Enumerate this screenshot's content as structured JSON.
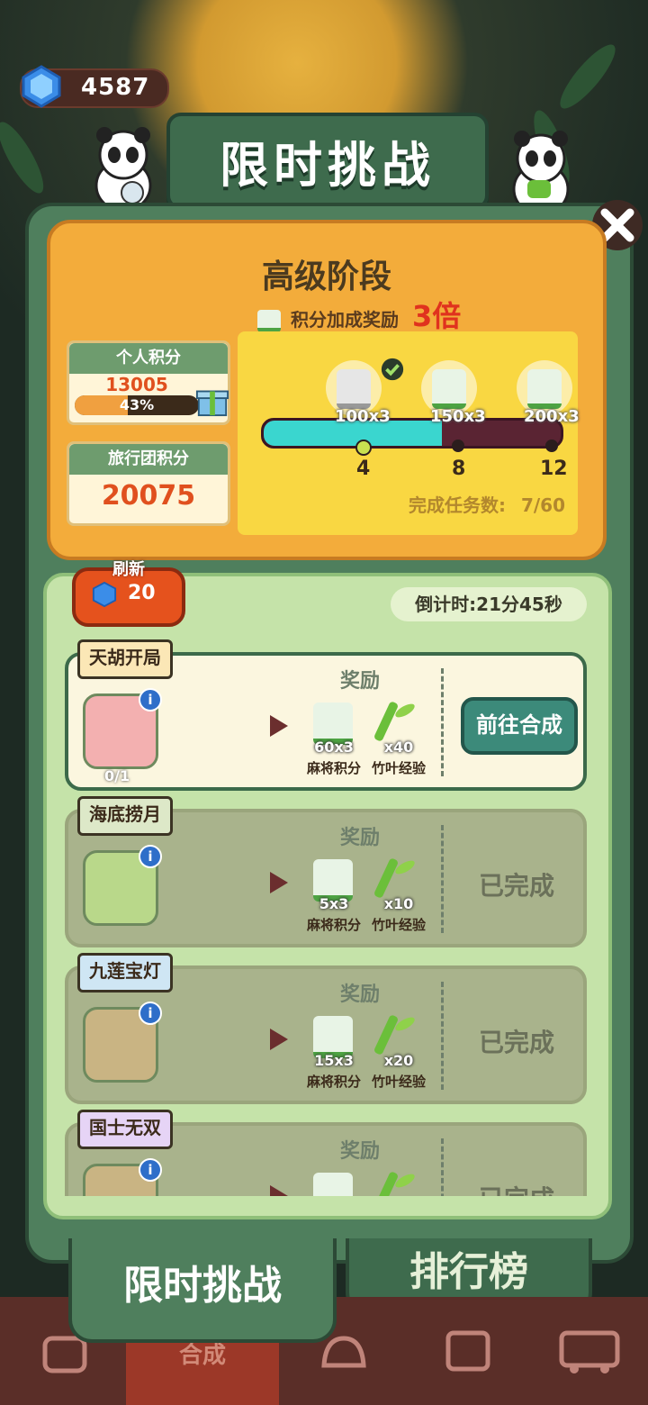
{
  "currency": {
    "gems": "4587",
    "icon": "blue-gem-icon"
  },
  "title": "限时挑战",
  "stage": {
    "title": "高级阶段",
    "bonus_label": "积分加成奖励",
    "bonus_multiplier": "3倍"
  },
  "personal_points": {
    "label": "个人积分",
    "value": "13005",
    "percent_text": "43%",
    "percent": 43
  },
  "group_points": {
    "label": "旅行团积分",
    "value": "20075"
  },
  "progress": {
    "milestones": [
      {
        "reward": "100x3",
        "threshold": "4",
        "claimed": true
      },
      {
        "reward": "150x3",
        "threshold": "8",
        "claimed": false
      },
      {
        "reward": "200x3",
        "threshold": "12",
        "claimed": false
      }
    ],
    "completed_label": "完成任务数:",
    "completed_value": "7/60",
    "fill_fraction": 0.6
  },
  "refresh": {
    "label": "刷新",
    "cost": "20"
  },
  "countdown": "倒计时:21分45秒",
  "tasks": [
    {
      "name": "天胡开局",
      "count": "0/1",
      "reward_title": "奖励",
      "rewards": [
        {
          "amount": "60x3",
          "name": "麻将积分"
        },
        {
          "amount": "x40",
          "name": "竹叶经验"
        }
      ],
      "action": "前往合成",
      "status": "active"
    },
    {
      "name": "海底捞月",
      "reward_title": "奖励",
      "rewards": [
        {
          "amount": "5x3",
          "name": "麻将积分"
        },
        {
          "amount": "x10",
          "name": "竹叶经验"
        }
      ],
      "action": "已完成",
      "status": "done"
    },
    {
      "name": "九莲宝灯",
      "reward_title": "奖励",
      "rewards": [
        {
          "amount": "15x3",
          "name": "麻将积分"
        },
        {
          "amount": "x20",
          "name": "竹叶经验"
        }
      ],
      "action": "已完成",
      "status": "done"
    },
    {
      "name": "国士无双",
      "reward_title": "奖励",
      "rewards": [
        {
          "amount": "",
          "name": ""
        },
        {
          "amount": "",
          "name": ""
        }
      ],
      "action": "已完成",
      "status": "done"
    }
  ],
  "tabs": {
    "active": "限时挑战",
    "inactive": "排行榜"
  },
  "bottom_nav": {
    "center_label": "合成"
  },
  "colors": {
    "frame": "#4f7f5d",
    "card": "#f3ac3b",
    "accent_red": "#e0321e",
    "bar_fill": "#3ad6cf"
  }
}
